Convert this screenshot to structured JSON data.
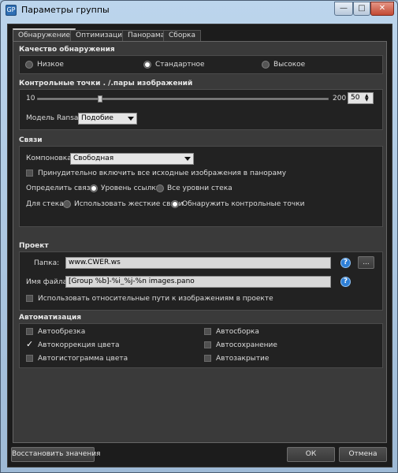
{
  "window": {
    "title": "Параметры группы",
    "icon_text": "GP"
  },
  "tabs": [
    "Обнаружение",
    "Оптимизация",
    "Панорама",
    "Сборка"
  ],
  "detection_quality": {
    "title": "Качество обнаружения",
    "options": [
      "Низкое",
      "Стандартное",
      "Высокое"
    ],
    "selected": "Стандартное"
  },
  "control_points": {
    "title": "Контрольные точки . /.пары изображений",
    "slider_min": "10",
    "slider_max": "200",
    "value": "50",
    "slider_level": 0.21,
    "ransac_label": "Модель Ransac:",
    "ransac_value": "Подобие"
  },
  "links": {
    "title": "Связи",
    "layout_label": "Компоновка:",
    "layout_value": "Свободная",
    "force_include": "Принудительно включить все исходные изображения в панораму",
    "define_label": "Определить связи:",
    "define_opts": [
      "Уровень ссылки",
      "Все уровни стека"
    ],
    "stack_label": "Для стека:",
    "stack_opts": [
      "Использовать жесткие связи",
      "Обнаружить контрольные точки"
    ]
  },
  "project": {
    "title": "Проект",
    "folder_label": "Папка:",
    "folder_value": "www.CWER.ws",
    "file_label": "Имя файла:",
    "file_value": "[Group %b]-%i_%j-%n images.pano",
    "relative_paths": "Использовать относительные пути к изображениям в проекте",
    "browse_label": "..."
  },
  "automation": {
    "title": "Автоматизация",
    "left": [
      {
        "label": "Автообрезка",
        "checked": false
      },
      {
        "label": "Автокоррекция цвета",
        "checked": true
      },
      {
        "label": "Автогистограмма цвета",
        "checked": false
      }
    ],
    "right": [
      {
        "label": "Автосборка",
        "checked": false
      },
      {
        "label": "Автосохранение",
        "checked": false
      },
      {
        "label": "Автозакрытие",
        "checked": false
      }
    ]
  },
  "buttons": {
    "restore": "Восстановить значения",
    "ok": "ОК",
    "cancel": "Отмена"
  }
}
